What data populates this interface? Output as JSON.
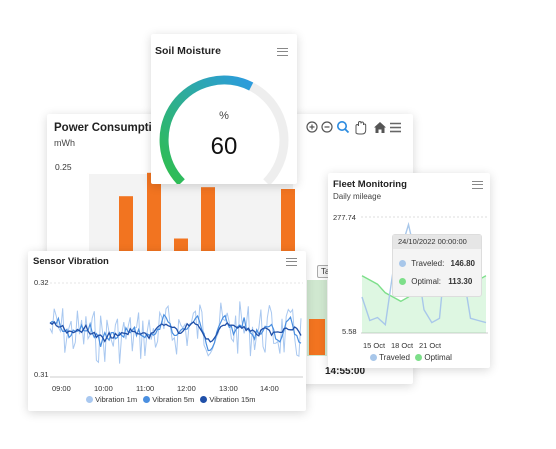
{
  "soil": {
    "title": "Soil Moisture",
    "unit": "%",
    "value": "60",
    "level": 0.6,
    "colors": {
      "track": "#eeeeee",
      "from": "#2fbf4b",
      "to": "#2c9be0"
    }
  },
  "power": {
    "title": "Power Consumption",
    "unit": "mWh",
    "ytick": "0.25",
    "time": "14:55:00",
    "color": "#f27420",
    "bars": [
      0.62,
      0.88,
      0.15,
      0.72,
      0.7
    ],
    "partial_label": "Ta"
  },
  "fleet": {
    "title": "Fleet Monitoring",
    "subtitle": "Daily mileage",
    "ymax": "277.74",
    "ymin": "5.58",
    "xticks": [
      "15 Oct",
      "18 Oct",
      "21 Oct"
    ],
    "tooltip": {
      "date": "24/10/2022 00:00:00",
      "rows": [
        {
          "label": "Traveled:",
          "value": "146.80",
          "color": "#a8c7ea"
        },
        {
          "label": "Optimal:",
          "value": "113.30",
          "color": "#7ddf8a"
        }
      ]
    },
    "legend": [
      {
        "label": "Traveled",
        "color": "#a8c7ea"
      },
      {
        "label": "Optimal",
        "color": "#7ddf8a"
      }
    ],
    "series": {
      "traveled": [
        90,
        35,
        42,
        25,
        150,
        200,
        260,
        180,
        60,
        30,
        40,
        230,
        200,
        150,
        40,
        35,
        30
      ],
      "optimal": [
        140,
        130,
        120,
        100,
        90,
        80,
        90,
        110,
        130,
        120,
        115,
        110,
        118,
        120,
        125,
        130,
        140
      ]
    }
  },
  "vibration": {
    "title": "Sensor Vibration",
    "ymax": "0.32",
    "ymin": "0.31",
    "xticks": [
      "09:00",
      "10:00",
      "11:00",
      "12:00",
      "13:00",
      "14:00"
    ],
    "legend": [
      {
        "label": "Vibration 1m",
        "color": "#a9c8f0"
      },
      {
        "label": "Vibration 5m",
        "color": "#4a8fe0"
      },
      {
        "label": "Vibration 15m",
        "color": "#1f4fa8"
      }
    ]
  }
}
